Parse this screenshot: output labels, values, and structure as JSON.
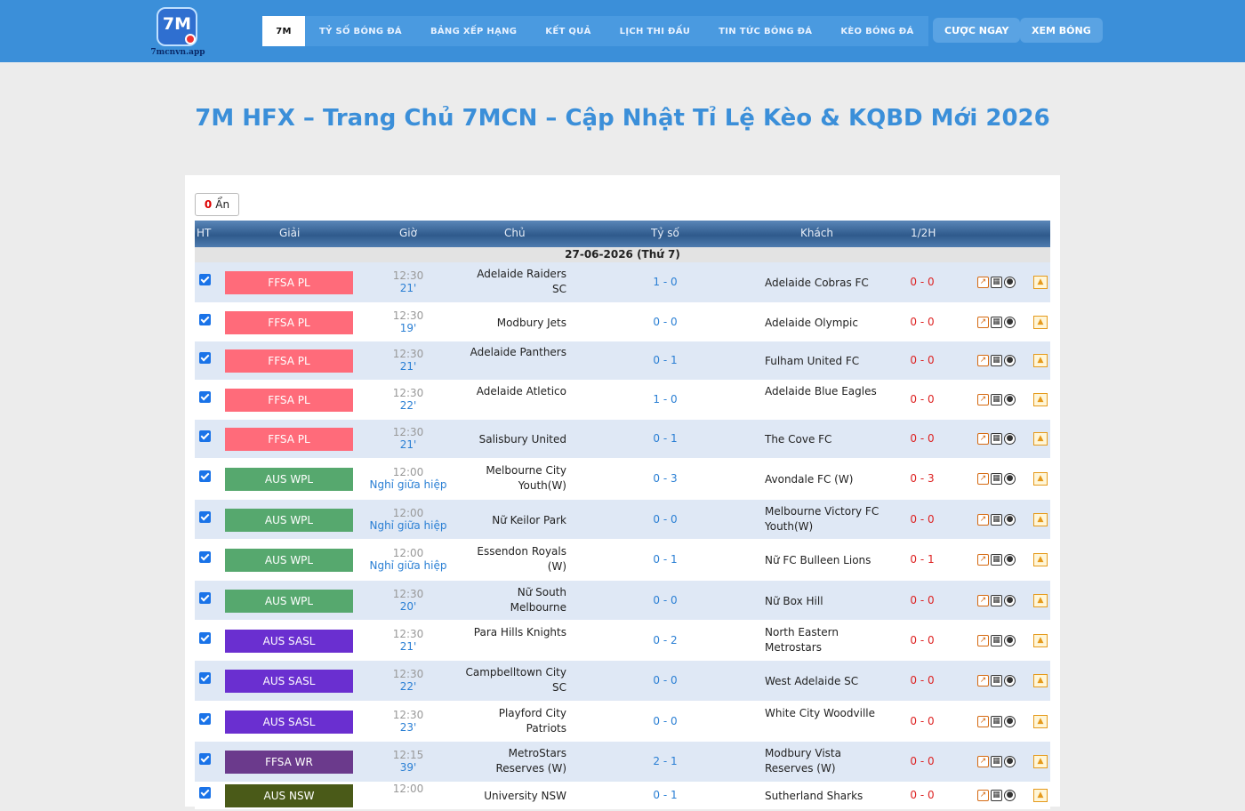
{
  "header": {
    "logo_text": "7M",
    "logo_sub": "7mcnvn.app",
    "nav": [
      {
        "label": "7M",
        "active": true
      },
      {
        "label": "TỶ SỐ BÓNG ĐÁ"
      },
      {
        "label": "BẢNG XẾP HẠNG"
      },
      {
        "label": "KẾT QUẢ"
      },
      {
        "label": "LỊCH THI ĐẤU"
      },
      {
        "label": "TIN TỨC BÓNG ĐÁ"
      },
      {
        "label": "KÈO BÓNG ĐÁ"
      }
    ],
    "cta_bet": "CƯỢC NGAY",
    "cta_watch": "XEM BÓNG"
  },
  "page_title": "7M HFX – Trang Chủ 7MCN – Cập Nhật Tỉ Lệ Kèo & KQBD Mới 2026",
  "hide_button": {
    "count": "0",
    "label": "Ẩn"
  },
  "table": {
    "headers": {
      "ht": "HT",
      "league": "Giải",
      "time": "Giờ",
      "home": "Chủ",
      "score": "Tỷ số",
      "away": "Khách",
      "half": "1/2H"
    },
    "date": "27-06-2026 (Thứ 7)",
    "rows": [
      {
        "league": "FFSA PL",
        "color": "#ff6b7a",
        "time": "12:30",
        "status": "21'",
        "home": "Adelaide Raiders SC",
        "score": "1 - 0",
        "away": "Adelaide Cobras FC",
        "half": "0 - 0"
      },
      {
        "league": "FFSA PL",
        "color": "#ff6b7a",
        "time": "12:30",
        "status": "19'",
        "home": "Modbury Jets",
        "score": "0 - 0",
        "away": "Adelaide Olympic",
        "half": "0 - 0"
      },
      {
        "league": "FFSA PL",
        "color": "#ff6b7a",
        "time": "12:30",
        "status": "21'",
        "home": "Adelaide Panthers",
        "score": "0 - 1",
        "away": "Fulham United FC",
        "half": "0 - 0"
      },
      {
        "league": "FFSA PL",
        "color": "#ff6b7a",
        "time": "12:30",
        "status": "22'",
        "home": "Adelaide Atletico",
        "score": "1 - 0",
        "away": "Adelaide Blue Eagles",
        "half": "0 - 0"
      },
      {
        "league": "FFSA PL",
        "color": "#ff6b7a",
        "time": "12:30",
        "status": "21'",
        "home": "Salisbury United",
        "score": "0 - 1",
        "away": "The Cove FC",
        "half": "0 - 0"
      },
      {
        "league": "AUS WPL",
        "color": "#56a86e",
        "time": "12:00",
        "status": "Nghỉ giữa hiệp",
        "home": "Melbourne City Youth(W)",
        "score": "0 - 3",
        "away": "Avondale FC (W)",
        "half": "0 - 3"
      },
      {
        "league": "AUS WPL",
        "color": "#56a86e",
        "time": "12:00",
        "status": "Nghỉ giữa hiệp",
        "home": "Nữ Keilor Park",
        "score": "0 - 0",
        "away": "Melbourne Victory FC Youth(W)",
        "half": "0 - 0"
      },
      {
        "league": "AUS WPL",
        "color": "#56a86e",
        "time": "12:00",
        "status": "Nghỉ giữa hiệp",
        "home": "Essendon Royals (W)",
        "score": "0 - 1",
        "away": "Nữ FC Bulleen Lions",
        "half": "0 - 1"
      },
      {
        "league": "AUS WPL",
        "color": "#56a86e",
        "time": "12:30",
        "status": "20'",
        "home": "Nữ South Melbourne",
        "score": "0 - 0",
        "away": "Nữ Box Hill",
        "half": "0 - 0"
      },
      {
        "league": "AUS SASL",
        "color": "#6a2fd0",
        "time": "12:30",
        "status": "21'",
        "home": "Para Hills Knights",
        "score": "0 - 2",
        "away": "North Eastern Metrostars",
        "half": "0 - 0"
      },
      {
        "league": "AUS SASL",
        "color": "#6a2fd0",
        "time": "12:30",
        "status": "22'",
        "home": "Campbelltown City SC",
        "score": "0 - 0",
        "away": "West Adelaide SC",
        "half": "0 - 0"
      },
      {
        "league": "AUS SASL",
        "color": "#6a2fd0",
        "time": "12:30",
        "status": "23'",
        "home": "Playford City Patriots",
        "score": "0 - 0",
        "away": "White City Woodville",
        "half": "0 - 0"
      },
      {
        "league": "FFSA WR",
        "color": "#6b3a8c",
        "time": "12:15",
        "status": "39'",
        "home": "MetroStars Reserves (W)",
        "score": "2 - 1",
        "away": "Modbury Vista Reserves (W)",
        "half": "0 - 0"
      },
      {
        "league": "AUS NSW",
        "color": "#4a5a18",
        "time": "12:00",
        "status": "",
        "home": "University NSW",
        "score": "0 - 1",
        "away": "Sutherland Sharks",
        "half": "0 - 0"
      }
    ]
  }
}
